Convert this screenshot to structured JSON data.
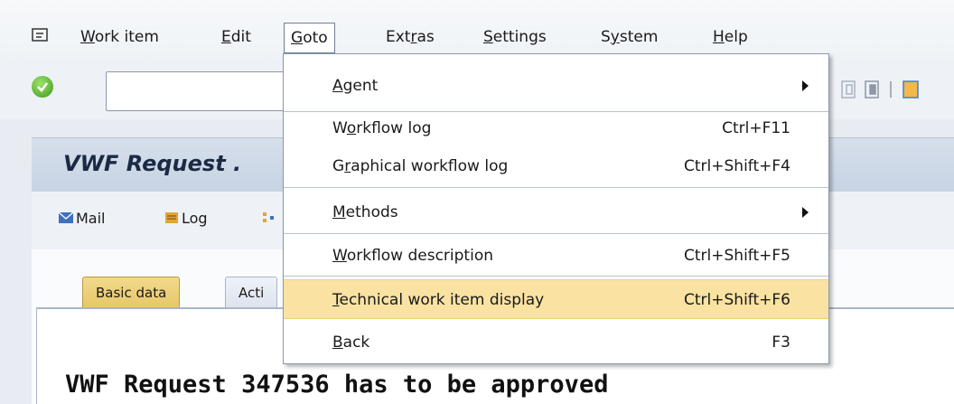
{
  "menubar": {
    "items": [
      {
        "label": "Work item",
        "u": "W",
        "rest": "ork item"
      },
      {
        "label": "Edit",
        "u": "E",
        "rest": "dit"
      },
      {
        "label": "Goto",
        "u": "G",
        "rest": "oto"
      },
      {
        "label": "Extras",
        "pre": "Ext",
        "u": "r",
        "rest": "as"
      },
      {
        "label": "Settings",
        "u": "S",
        "rest": "ettings"
      },
      {
        "label": "System",
        "pre": "S",
        "u": "y",
        "rest": "stem"
      },
      {
        "label": "Help",
        "u": "H",
        "rest": "elp"
      }
    ]
  },
  "title": {
    "text": "VWF Request ."
  },
  "app_toolbar": {
    "mail": "Mail",
    "log": "Log"
  },
  "tabs": {
    "basic": "Basic data",
    "acti": "Acti"
  },
  "content": {
    "text": "VWF Request 347536 has to be approved"
  },
  "goto_menu": {
    "items": [
      {
        "pre": "",
        "u": "A",
        "rest": "gent",
        "shortcut": "",
        "submenu": true
      },
      {
        "pre": "W",
        "u": "o",
        "rest": "rkflow log",
        "shortcut": "Ctrl+F11",
        "submenu": false
      },
      {
        "pre": "G",
        "u": "r",
        "rest": "aphical workflow log",
        "shortcut": "Ctrl+Shift+F4",
        "submenu": false
      },
      {
        "pre": "",
        "u": "M",
        "rest": "ethods",
        "shortcut": "",
        "submenu": true
      },
      {
        "pre": "",
        "u": "W",
        "rest": "orkflow description",
        "shortcut": "Ctrl+Shift+F5",
        "submenu": false
      },
      {
        "pre": "",
        "u": "T",
        "rest": "echnical work item display",
        "shortcut": "Ctrl+Shift+F6",
        "submenu": false,
        "highlighted": true
      },
      {
        "pre": "",
        "u": "B",
        "rest": "ack",
        "shortcut": "F3",
        "submenu": false
      }
    ]
  },
  "colors": {
    "highlight": "#f9e2a2",
    "title_bar": "#c7d3e3",
    "ok_green": "#3c9a1c"
  }
}
